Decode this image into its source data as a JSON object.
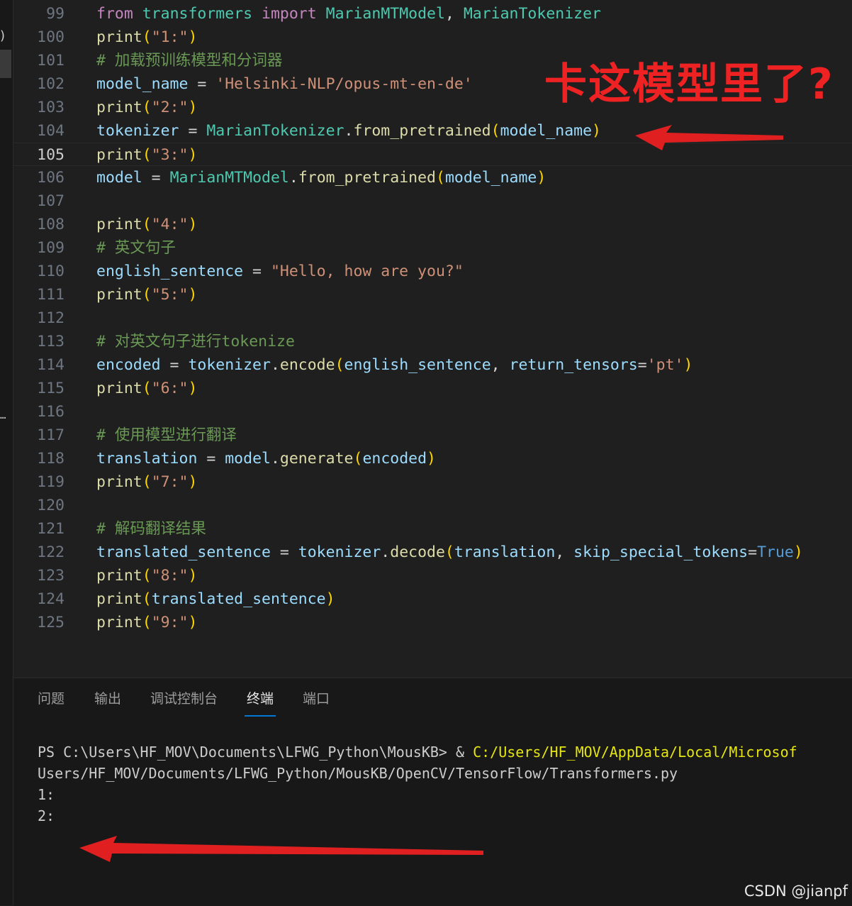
{
  "editor": {
    "lines": [
      {
        "n": "99",
        "tokens": [
          [
            "kw",
            "from"
          ],
          [
            "op",
            " "
          ],
          [
            "mod",
            "transformers"
          ],
          [
            "op",
            " "
          ],
          [
            "kw",
            "import"
          ],
          [
            "op",
            " "
          ],
          [
            "cls",
            "MarianMTModel"
          ],
          [
            "op",
            ", "
          ],
          [
            "cls",
            "MarianTokenizer"
          ]
        ]
      },
      {
        "n": "100",
        "tokens": [
          [
            "fn",
            "print"
          ],
          [
            "p1",
            "("
          ],
          [
            "str",
            "\"1:\""
          ],
          [
            "p1",
            ")"
          ]
        ]
      },
      {
        "n": "101",
        "tokens": [
          [
            "cmt",
            "# 加载预训练模型和分词器"
          ]
        ]
      },
      {
        "n": "102",
        "tokens": [
          [
            "var",
            "model_name"
          ],
          [
            "op",
            " = "
          ],
          [
            "str",
            "'Helsinki-NLP/opus-mt-en-de'"
          ]
        ]
      },
      {
        "n": "103",
        "tokens": [
          [
            "fn",
            "print"
          ],
          [
            "p1",
            "("
          ],
          [
            "str",
            "\"2:\""
          ],
          [
            "p1",
            ")"
          ]
        ]
      },
      {
        "n": "104",
        "tokens": [
          [
            "var",
            "tokenizer"
          ],
          [
            "op",
            " = "
          ],
          [
            "cls",
            "MarianTokenizer"
          ],
          [
            "op",
            "."
          ],
          [
            "fn",
            "from_pretrained"
          ],
          [
            "p1",
            "("
          ],
          [
            "var",
            "model_name"
          ],
          [
            "p1",
            ")"
          ]
        ]
      },
      {
        "n": "105",
        "current": true,
        "tokens": [
          [
            "fn",
            "print"
          ],
          [
            "p1",
            "("
          ],
          [
            "str",
            "\"3:\""
          ],
          [
            "p1",
            ")"
          ]
        ]
      },
      {
        "n": "106",
        "tokens": [
          [
            "var",
            "model"
          ],
          [
            "op",
            " = "
          ],
          [
            "cls",
            "MarianMTModel"
          ],
          [
            "op",
            "."
          ],
          [
            "fn",
            "from_pretrained"
          ],
          [
            "p1",
            "("
          ],
          [
            "var",
            "model_name"
          ],
          [
            "p1",
            ")"
          ]
        ]
      },
      {
        "n": "107",
        "tokens": []
      },
      {
        "n": "108",
        "tokens": [
          [
            "fn",
            "print"
          ],
          [
            "p1",
            "("
          ],
          [
            "str",
            "\"4:\""
          ],
          [
            "p1",
            ")"
          ]
        ]
      },
      {
        "n": "109",
        "tokens": [
          [
            "cmt",
            "# 英文句子"
          ]
        ]
      },
      {
        "n": "110",
        "tokens": [
          [
            "var",
            "english_sentence"
          ],
          [
            "op",
            " = "
          ],
          [
            "str",
            "\"Hello, how are you?\""
          ]
        ]
      },
      {
        "n": "111",
        "tokens": [
          [
            "fn",
            "print"
          ],
          [
            "p1",
            "("
          ],
          [
            "str",
            "\"5:\""
          ],
          [
            "p1",
            ")"
          ]
        ]
      },
      {
        "n": "112",
        "tokens": []
      },
      {
        "n": "113",
        "tokens": [
          [
            "cmt",
            "# 对英文句子进行tokenize"
          ]
        ]
      },
      {
        "n": "114",
        "tokens": [
          [
            "var",
            "encoded"
          ],
          [
            "op",
            " = "
          ],
          [
            "var",
            "tokenizer"
          ],
          [
            "op",
            "."
          ],
          [
            "fn",
            "encode"
          ],
          [
            "p1",
            "("
          ],
          [
            "var",
            "english_sentence"
          ],
          [
            "op",
            ", "
          ],
          [
            "var",
            "return_tensors"
          ],
          [
            "op",
            "="
          ],
          [
            "str",
            "'pt'"
          ],
          [
            "p1",
            ")"
          ]
        ]
      },
      {
        "n": "115",
        "tokens": [
          [
            "fn",
            "print"
          ],
          [
            "p1",
            "("
          ],
          [
            "str",
            "\"6:\""
          ],
          [
            "p1",
            ")"
          ]
        ]
      },
      {
        "n": "116",
        "tokens": []
      },
      {
        "n": "117",
        "tokens": [
          [
            "cmt",
            "# 使用模型进行翻译"
          ]
        ]
      },
      {
        "n": "118",
        "tokens": [
          [
            "var",
            "translation"
          ],
          [
            "op",
            " = "
          ],
          [
            "var",
            "model"
          ],
          [
            "op",
            "."
          ],
          [
            "fn",
            "generate"
          ],
          [
            "p1",
            "("
          ],
          [
            "var",
            "encoded"
          ],
          [
            "p1",
            ")"
          ]
        ]
      },
      {
        "n": "119",
        "tokens": [
          [
            "fn",
            "print"
          ],
          [
            "p1",
            "("
          ],
          [
            "str",
            "\"7:\""
          ],
          [
            "p1",
            ")"
          ]
        ]
      },
      {
        "n": "120",
        "tokens": []
      },
      {
        "n": "121",
        "tokens": [
          [
            "cmt",
            "# 解码翻译结果"
          ]
        ]
      },
      {
        "n": "122",
        "tokens": [
          [
            "var",
            "translated_sentence"
          ],
          [
            "op",
            " = "
          ],
          [
            "var",
            "tokenizer"
          ],
          [
            "op",
            "."
          ],
          [
            "fn",
            "decode"
          ],
          [
            "p1",
            "("
          ],
          [
            "var",
            "translation"
          ],
          [
            "op",
            ", "
          ],
          [
            "var",
            "skip_special_tokens"
          ],
          [
            "op",
            "="
          ],
          [
            "bool",
            "True"
          ],
          [
            "p1",
            ")"
          ]
        ]
      },
      {
        "n": "123",
        "tokens": [
          [
            "fn",
            "print"
          ],
          [
            "p1",
            "("
          ],
          [
            "str",
            "\"8:\""
          ],
          [
            "p1",
            ")"
          ]
        ]
      },
      {
        "n": "124",
        "tokens": [
          [
            "fn",
            "print"
          ],
          [
            "p1",
            "("
          ],
          [
            "var",
            "translated_sentence"
          ],
          [
            "p1",
            ")"
          ]
        ]
      },
      {
        "n": "125",
        "tokens": [
          [
            "fn",
            "print"
          ],
          [
            "p1",
            "("
          ],
          [
            "str",
            "\"9:\""
          ],
          [
            "p1",
            ")"
          ]
        ]
      }
    ]
  },
  "annotation": {
    "text": "卡这模型里了?",
    "color": "#ee2222"
  },
  "panel": {
    "tabs": [
      {
        "label": "问题",
        "active": false
      },
      {
        "label": "输出",
        "active": false
      },
      {
        "label": "调试控制台",
        "active": false
      },
      {
        "label": "终端",
        "active": true
      },
      {
        "label": "端口",
        "active": false
      }
    ],
    "terminal": {
      "prompt": "PS C:\\Users\\HF_MOV\\Documents\\LFWG_Python\\MousKB> & ",
      "exe_path": "C:/Users/HF_MOV/AppData/Local/Microsof",
      "script_path": "Users/HF_MOV/Documents/LFWG_Python/MousKB/OpenCV/TensorFlow/Transformers.py",
      "output": [
        "1:",
        "2:"
      ]
    }
  },
  "watermark": "CSDN @jianpf",
  "colors": {
    "accent": "#0078d4",
    "arrow": "#e02020",
    "background": "#1f1f1f"
  }
}
